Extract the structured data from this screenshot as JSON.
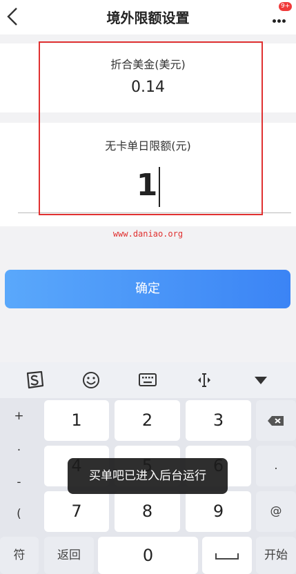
{
  "header": {
    "title": "境外限额设置",
    "badge": "9+"
  },
  "converted": {
    "label": "折合美金(美元)",
    "value": "0.14"
  },
  "limit": {
    "label": "无卡单日限额(元)",
    "value": "1"
  },
  "watermark": "www.daniao.org",
  "confirm_label": "确定",
  "toast": "买单吧已进入后台运行",
  "keyboard": {
    "side_symbols": [
      "+",
      "·",
      "-",
      "("
    ],
    "keys": [
      "1",
      "2",
      "3",
      "4",
      "5",
      "6",
      "7",
      "8",
      "9",
      "0"
    ],
    "symbol_key": "符",
    "back_key": "返回",
    "start_key": "开始",
    "at_key": "@",
    "dot_key": "."
  },
  "colors": {
    "accent": "#3b84f5",
    "highlight_border": "#e03030"
  }
}
